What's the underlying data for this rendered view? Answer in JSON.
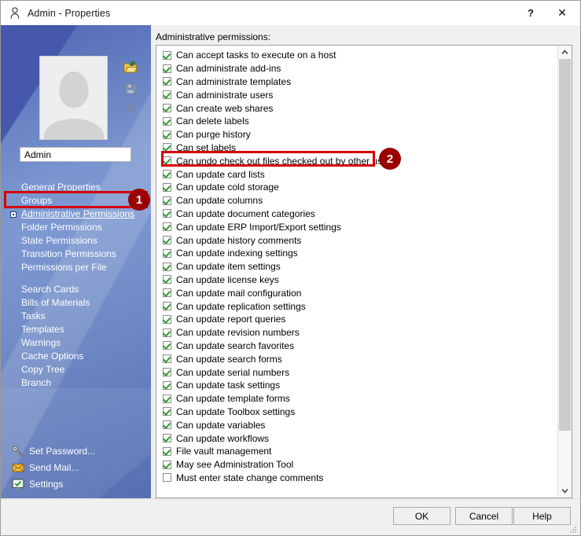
{
  "window": {
    "title": "Admin - Properties",
    "title_icon": "person-icon",
    "help_label": "?",
    "close_label": "✕"
  },
  "left_panel": {
    "avatar_alt": "user-avatar-placeholder",
    "icons": [
      {
        "name": "open-folder-icon",
        "enabled": true
      },
      {
        "name": "save-disk-icon",
        "enabled": false
      },
      {
        "name": "delete-x-icon",
        "enabled": false
      }
    ],
    "name_field": {
      "value": "Admin",
      "placeholder": ""
    },
    "nav_items": [
      {
        "label": "General Properties",
        "selected": false,
        "gap_after": false
      },
      {
        "label": "Groups",
        "selected": false,
        "gap_after": false
      },
      {
        "label": "Administrative Permissions",
        "selected": true,
        "gap_after": false
      },
      {
        "label": "Folder Permissions",
        "selected": false,
        "gap_after": false
      },
      {
        "label": "State Permissions",
        "selected": false,
        "gap_after": false
      },
      {
        "label": "Transition Permissions",
        "selected": false,
        "gap_after": false
      },
      {
        "label": "Permissions per File",
        "selected": false,
        "gap_after": true
      },
      {
        "label": "Search Cards",
        "selected": false,
        "gap_after": false
      },
      {
        "label": "Bills of Materials",
        "selected": false,
        "gap_after": false
      },
      {
        "label": "Tasks",
        "selected": false,
        "gap_after": false
      },
      {
        "label": "Templates",
        "selected": false,
        "gap_after": false
      },
      {
        "label": "Warnings",
        "selected": false,
        "gap_after": false
      },
      {
        "label": "Cache Options",
        "selected": false,
        "gap_after": false
      },
      {
        "label": "Copy Tree",
        "selected": false,
        "gap_after": false
      },
      {
        "label": "Branch",
        "selected": false,
        "gap_after": false
      }
    ],
    "bottom_links": [
      {
        "label": "Set Password...",
        "icon": "key-icon"
      },
      {
        "label": "Send Mail...",
        "icon": "envelope-icon"
      },
      {
        "label": "Settings",
        "icon": "monitor-check-icon"
      }
    ]
  },
  "main": {
    "list_label": "Administrative permissions:",
    "permissions": [
      {
        "label": "Can accept tasks to execute on a host",
        "checked": true
      },
      {
        "label": "Can administrate add-ins",
        "checked": true
      },
      {
        "label": "Can administrate templates",
        "checked": true
      },
      {
        "label": "Can administrate users",
        "checked": true
      },
      {
        "label": "Can create web shares",
        "checked": true
      },
      {
        "label": "Can delete labels",
        "checked": true
      },
      {
        "label": "Can purge history",
        "checked": true
      },
      {
        "label": "Can set labels",
        "checked": true
      },
      {
        "label": "Can undo check out files checked out by other users",
        "checked": true
      },
      {
        "label": "Can update card lists",
        "checked": true
      },
      {
        "label": "Can update cold storage",
        "checked": true
      },
      {
        "label": "Can update columns",
        "checked": true
      },
      {
        "label": "Can update document categories",
        "checked": true
      },
      {
        "label": "Can update ERP Import/Export settings",
        "checked": true
      },
      {
        "label": "Can update history comments",
        "checked": true
      },
      {
        "label": "Can update indexing settings",
        "checked": true
      },
      {
        "label": "Can update item settings",
        "checked": true
      },
      {
        "label": "Can update license keys",
        "checked": true
      },
      {
        "label": "Can update mail configuration",
        "checked": true
      },
      {
        "label": "Can update replication settings",
        "checked": true
      },
      {
        "label": "Can update report queries",
        "checked": true
      },
      {
        "label": "Can update revision numbers",
        "checked": true
      },
      {
        "label": "Can update search favorites",
        "checked": true
      },
      {
        "label": "Can update search forms",
        "checked": true
      },
      {
        "label": "Can update serial numbers",
        "checked": true
      },
      {
        "label": "Can update task settings",
        "checked": true
      },
      {
        "label": "Can update template forms",
        "checked": true
      },
      {
        "label": "Can update Toolbox settings",
        "checked": true
      },
      {
        "label": "Can update variables",
        "checked": true
      },
      {
        "label": "Can update workflows",
        "checked": true
      },
      {
        "label": "File vault management",
        "checked": true
      },
      {
        "label": "May see Administration Tool",
        "checked": true
      },
      {
        "label": "Must enter state change comments",
        "checked": false
      }
    ],
    "scrollbar": {
      "up_arrow": "▲",
      "down_arrow": "▼"
    }
  },
  "buttons": {
    "ok": "OK",
    "cancel": "Cancel",
    "help": "Help"
  },
  "annotations": [
    {
      "number": "1",
      "target": "Administrative Permissions"
    },
    {
      "number": "2",
      "target": "Can undo check out files checked out by other users"
    }
  ],
  "colors": {
    "annotation_box": "#d40000",
    "annotation_badge": "#9b0000",
    "checkmark": "#2f9b32",
    "panel_blue": "#6a84c4"
  }
}
